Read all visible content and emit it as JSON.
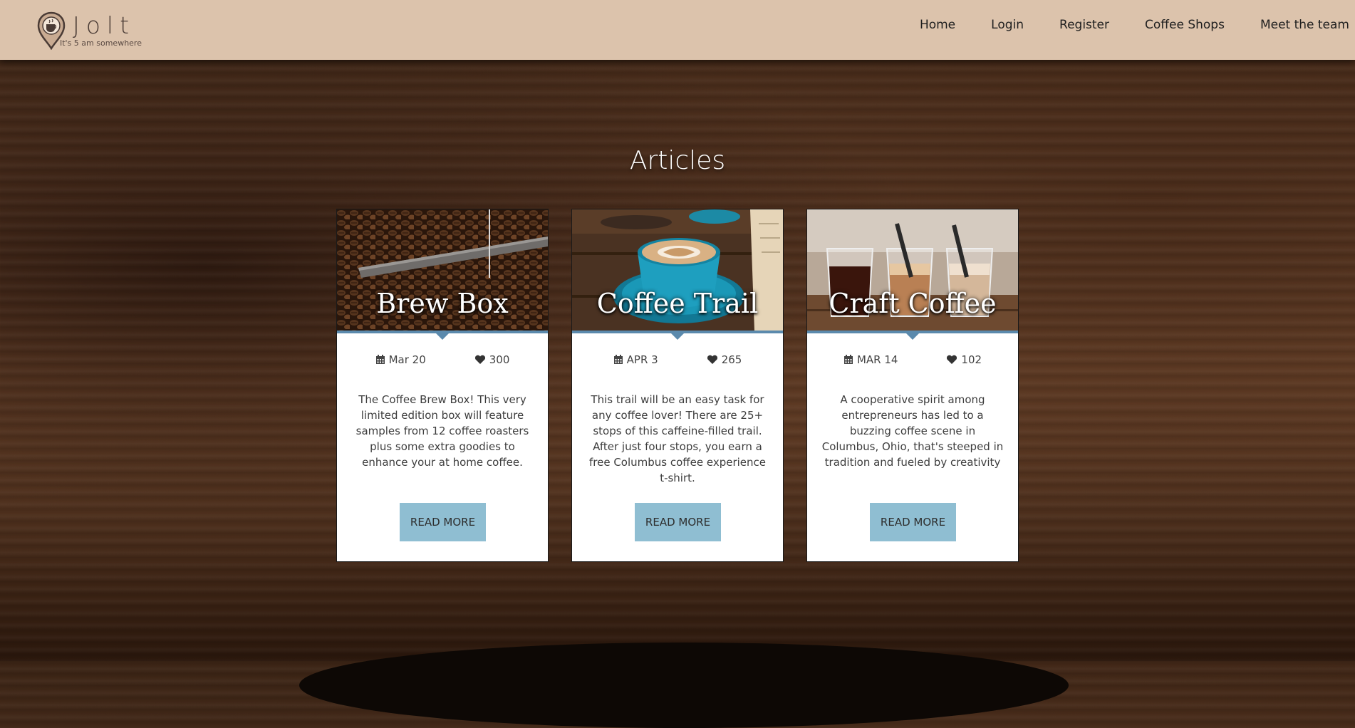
{
  "brand": {
    "name": "Jolt",
    "tagline": "It's 5 am somewhere"
  },
  "nav": {
    "items": [
      "Home",
      "Login",
      "Register",
      "Coffee Shops",
      "Meet the team"
    ]
  },
  "page": {
    "title": "Articles"
  },
  "icons": {
    "date": "calendar-icon",
    "likes": "heart-icon"
  },
  "colors": {
    "navbar": "#dcc3ac",
    "accent": "#5b8aad",
    "button": "#8fbed2"
  },
  "articles": [
    {
      "title": "Brew Box",
      "date": "Mar 20",
      "likes": "300",
      "description": "The Coffee Brew Box! This very limited edition box will feature samples from 12 coffee roasters plus some extra goodies to enhance your at home coffee.",
      "button": "READ MORE"
    },
    {
      "title": "Coffee Trail",
      "date": "APR 3",
      "likes": "265",
      "description": "This trail will be an easy task for any coffee lover! There are 25+ stops of this caffeine-filled trail. After just four stops, you earn a free Columbus coffee experience t-shirt.",
      "button": "READ MORE"
    },
    {
      "title": "Craft Coffee",
      "date": "MAR 14",
      "likes": "102",
      "description": "A cooperative spirit among entrepreneurs has led to a buzzing coffee scene in Columbus, Ohio, that's steeped in tradition and fueled by creativity",
      "button": "READ MORE"
    }
  ]
}
